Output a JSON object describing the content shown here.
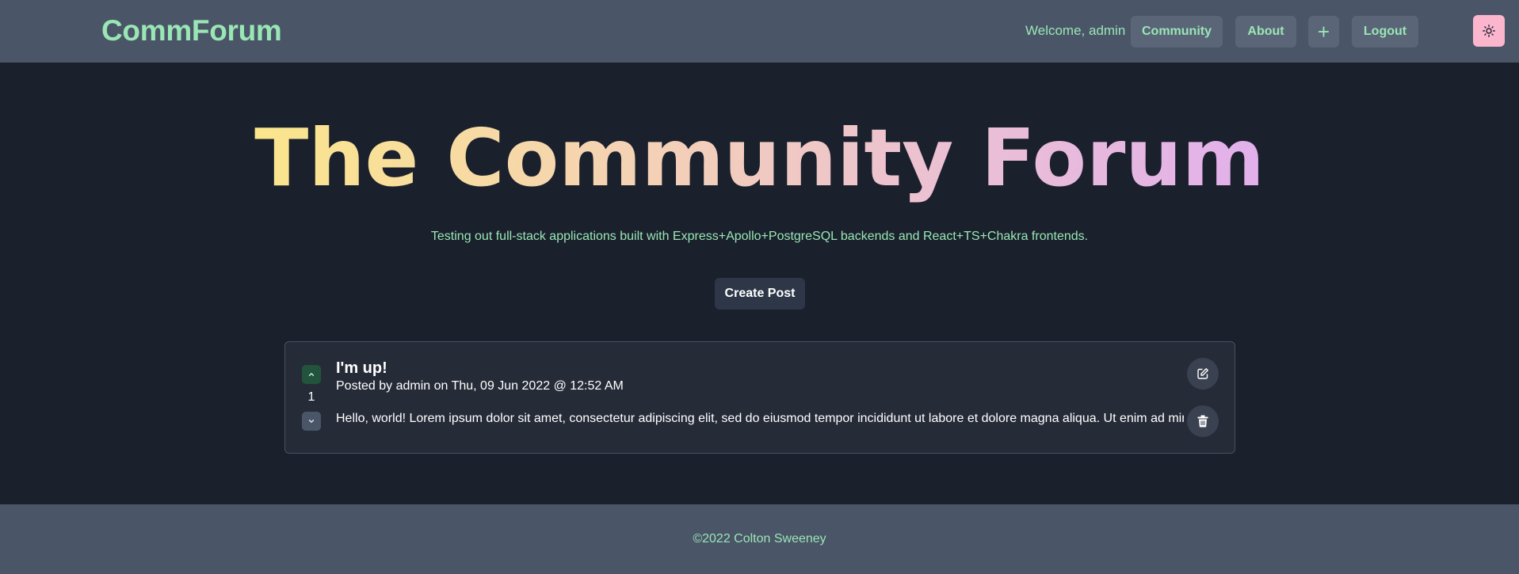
{
  "navbar": {
    "brand": "CommForum",
    "welcome_text": "Welcome, admin",
    "community_label": "Community",
    "about_label": "About",
    "plus_label": "+",
    "logout_label": "Logout",
    "theme_icon": "sun-icon"
  },
  "hero": {
    "title": "The Community Forum",
    "subtitle": "Testing out full-stack applications built with Express+Apollo+PostgreSQL backends and React+TS+Chakra frontends.",
    "create_post_label": "Create Post"
  },
  "posts": [
    {
      "title": "I'm up!",
      "meta": "Posted by admin on Thu, 09 Jun 2022 @ 12:52 AM",
      "body": "Hello, world! Lorem ipsum dolor sit amet, consectetur adipiscing elit, sed do eiusmod tempor incididunt ut labore et dolore magna aliqua. Ut enim ad minim veniam",
      "votes": "1",
      "upvote_icon": "chevron-up-icon",
      "downvote_icon": "chevron-down-icon",
      "edit_icon": "edit-icon",
      "delete_icon": "trash-icon"
    }
  ],
  "footer": {
    "text": "©2022 Colton Sweeney"
  },
  "colors": {
    "navbar_bg": "#4a5568",
    "page_bg": "#1a202c",
    "accent_green": "#9ae6b4",
    "theme_button": "#fbb6ce",
    "upvote_active": "#22543d"
  }
}
